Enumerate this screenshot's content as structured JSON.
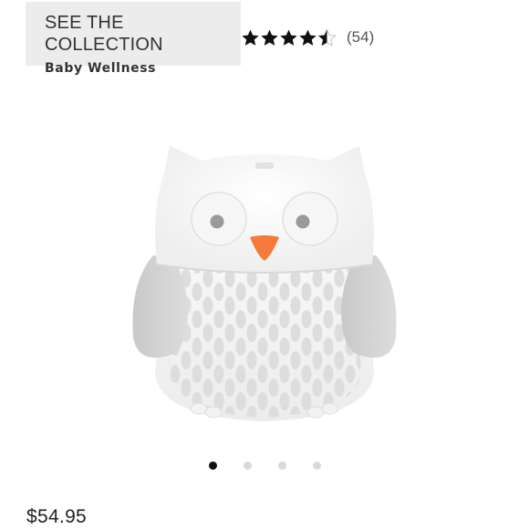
{
  "collection": {
    "heading": "SEE THE COLLECTION",
    "name": "Baby Wellness"
  },
  "rating": {
    "stars": 4.5,
    "max_stars": 5,
    "review_count_text": "(54)"
  },
  "product": {
    "image_icon": "owl-nightlight-image"
  },
  "carousel": {
    "total": 4,
    "active_index": 0
  },
  "price": "$54.95",
  "colors": {
    "collection_bg": "#ececec",
    "star_fill": "#111111",
    "dot_active": "#111111",
    "dot_inactive": "#d9d9d9",
    "owl_beak": "#f47b3c"
  }
}
